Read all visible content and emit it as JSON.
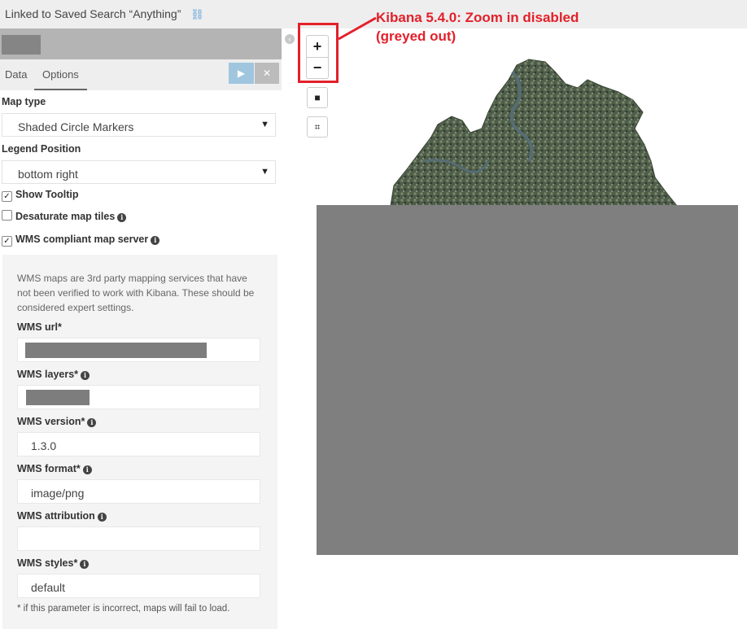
{
  "topbar": {
    "linked_search": "Linked to Saved Search “Anything”",
    "unlink_icon": "unlink-icon"
  },
  "sidebar": {
    "tabs": [
      {
        "label": "Data"
      },
      {
        "label": "Options",
        "active": true
      }
    ],
    "apply_icon": "play-icon",
    "discard_icon": "close-icon",
    "map_type": {
      "label": "Map type",
      "value": "Shaded Circle Markers"
    },
    "legend_position": {
      "label": "Legend Position",
      "value": "bottom right"
    },
    "show_tooltip": {
      "label": "Show Tooltip",
      "checked": true
    },
    "desaturate": {
      "label": "Desaturate map tiles",
      "checked": false
    },
    "wms_compliant": {
      "label": "WMS compliant map server",
      "checked": true
    },
    "wms": {
      "description": "WMS maps are 3rd party mapping services that have not been verified to work with Kibana. These should be considered expert settings.",
      "url": {
        "label": "WMS url*",
        "value": ""
      },
      "layers": {
        "label": "WMS layers*",
        "value": ""
      },
      "version": {
        "label": "WMS version*",
        "value": "1.3.0"
      },
      "format": {
        "label": "WMS format*",
        "value": "image/png"
      },
      "attribution": {
        "label": "WMS attribution",
        "value": ""
      },
      "styles": {
        "label": "WMS styles*",
        "value": "default"
      },
      "footnote": "* if this parameter is incorrect, maps will fail to load."
    }
  },
  "map": {
    "zoom_in": "+",
    "zoom_out": "−",
    "draw_rect_icon": "square-icon",
    "crop_icon": "crop-icon"
  },
  "annotation": {
    "line1": "Kibana 5.4.0: Zoom in disabled",
    "line2": "(greyed out)",
    "color": "#e3202a"
  },
  "colors": {
    "accent_blue": "#9fc6de",
    "map_grey": "#7f7f7f"
  }
}
